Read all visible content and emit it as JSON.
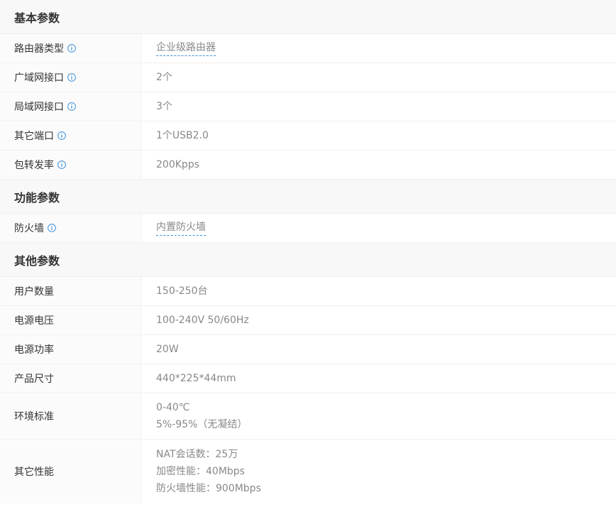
{
  "colors": {
    "header_bg": "#f8f8f8",
    "label_bg": "#fbfbfb",
    "label_text": "#333333",
    "value_text": "#888888",
    "info_icon": "#3b8fd9",
    "link_underline": "#3b8fd9"
  },
  "sections": [
    {
      "title": "基本参数",
      "rows": [
        {
          "label": "路由器类型",
          "info": true,
          "values": [
            "企业级路由器"
          ],
          "link": true
        },
        {
          "label": "广域网接口",
          "info": true,
          "values": [
            "2个"
          ]
        },
        {
          "label": "局域网接口",
          "info": true,
          "values": [
            "3个"
          ]
        },
        {
          "label": "其它端口",
          "info": true,
          "values": [
            "1个USB2.0"
          ]
        },
        {
          "label": "包转发率",
          "info": true,
          "values": [
            "200Kpps"
          ]
        }
      ]
    },
    {
      "title": "功能参数",
      "rows": [
        {
          "label": "防火墙",
          "info": true,
          "values": [
            "内置防火墙"
          ],
          "link": true
        }
      ]
    },
    {
      "title": "其他参数",
      "rows": [
        {
          "label": "用户数量",
          "info": false,
          "values": [
            "150-250台"
          ]
        },
        {
          "label": "电源电压",
          "info": false,
          "values": [
            "100-240V 50/60Hz"
          ]
        },
        {
          "label": "电源功率",
          "info": false,
          "values": [
            "20W"
          ]
        },
        {
          "label": "产品尺寸",
          "info": false,
          "values": [
            "440*225*44mm"
          ]
        },
        {
          "label": "环境标准",
          "info": false,
          "values": [
            "0-40℃",
            "5%-95%（无凝结）"
          ]
        },
        {
          "label": "其它性能",
          "info": false,
          "values": [
            "NAT会话数：25万",
            "加密性能：40Mbps",
            "防火墙性能：900Mbps"
          ]
        }
      ]
    }
  ]
}
